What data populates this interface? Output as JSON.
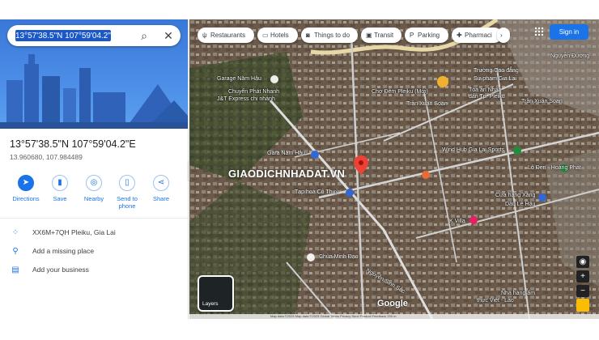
{
  "search": {
    "value": "13°57'38.5\"N 107°59'04.2\"E",
    "search_icon": "search-icon",
    "close_icon": "close-icon"
  },
  "place": {
    "title": "13°57'38.5\"N 107°59'04.2\"E",
    "coords": "13.960680, 107.984489"
  },
  "actions": [
    {
      "label": "Directions",
      "icon": "directions-icon"
    },
    {
      "label": "Save",
      "icon": "bookmark-icon"
    },
    {
      "label": "Nearby",
      "icon": "nearby-icon"
    },
    {
      "label": "Send to phone",
      "icon": "phone-icon"
    },
    {
      "label": "Share",
      "icon": "share-icon"
    }
  ],
  "rows": [
    {
      "text": "XX6M+7QH Pleiku, Gia Lai",
      "icon": "plus-code-icon"
    },
    {
      "text": "Add a missing place",
      "icon": "add-place-icon"
    },
    {
      "text": "Add your business",
      "icon": "business-icon"
    }
  ],
  "chips": [
    {
      "label": "Restaurants",
      "icon": "restaurant-icon"
    },
    {
      "label": "Hotels",
      "icon": "hotel-icon"
    },
    {
      "label": "Things to do",
      "icon": "camera-icon"
    },
    {
      "label": "Transit",
      "icon": "transit-icon"
    },
    {
      "label": "Parking",
      "icon": "parking-icon"
    },
    {
      "label": "Pharmaci",
      "icon": "pharmacy-icon"
    }
  ],
  "signin": "Sign in",
  "layers": "Layers",
  "google": "Google",
  "watermark": "GIAODICHNHADAT.VN",
  "footer": "Map data ©2025  Map data ©2025   Global   Terms   Privacy   Send Product Feedback   200 m",
  "map_labels": [
    {
      "text": "Garage Năm Hậu"
    },
    {
      "text": "Chuyển Phát Nhanh"
    },
    {
      "text": "J&T Express chi nhánh"
    },
    {
      "text": "Chợ Đêm Pleiku (Mới)"
    },
    {
      "text": "Trần Xuân Soạn"
    },
    {
      "text": "Trường Cao đẳng"
    },
    {
      "text": "Sư phạm Gia Lai"
    },
    {
      "text": "Tòa án Nhân"
    },
    {
      "text": "dân Tp. Pleiku"
    },
    {
      "text": "Trần Xuân Soạn"
    },
    {
      "text": "Nguyễn Đường"
    },
    {
      "text": "Gara Năm Hậu"
    },
    {
      "text": "Wind Hub Gia Lai Sports"
    },
    {
      "text": "Lô Đen - Hoàng Phát"
    },
    {
      "text": "Tạp hoá Cô Thuỷ"
    },
    {
      "text": "Cửa hàng Xăng"
    },
    {
      "text": "Dầu Lê Hậu"
    },
    {
      "text": "K Villa"
    },
    {
      "text": "Chùa Minh Đạo"
    },
    {
      "text": "Nhà hàng ẩm"
    },
    {
      "text": "thực Việt - Lào"
    },
    {
      "text": "Nguyễn Sinh Sắc"
    }
  ]
}
